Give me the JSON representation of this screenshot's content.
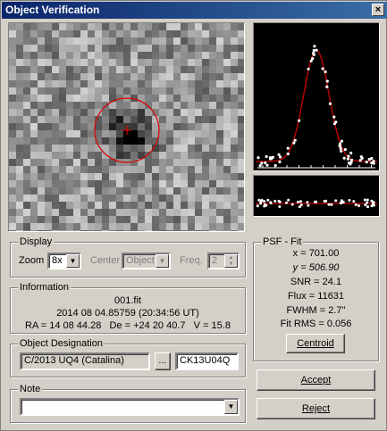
{
  "window": {
    "title": "Object Verification",
    "close_glyph": "×"
  },
  "display": {
    "label": "Display",
    "zoom_label": "Zoom",
    "zoom_value": "8x",
    "center_label": "Center",
    "center_value": "Object",
    "freq_label": "Freq.",
    "freq_value": "2"
  },
  "information": {
    "label": "Information",
    "filename": "001.fit",
    "datetime": "2014 08 04.85759 (20:34:56 UT)",
    "coords": "RA = 14 08 44.28   De = +24 20 40.7   V = 15.8"
  },
  "designation": {
    "label": "Object Designation",
    "name": "C/2013 UQ4 (Catalina)",
    "code": "CK13U04Q",
    "browse_label": "..."
  },
  "note": {
    "label": "Note",
    "value": ""
  },
  "psf": {
    "label": "PSF - Fit",
    "x": "x = 701.00",
    "y": "y = 506.90",
    "snr": "SNR = 24.1",
    "flux": "Flux = 11631",
    "fwhm": "FWHM = 2.7\"",
    "rms": "Fit RMS = 0.056",
    "centroid_label": "Centroid"
  },
  "buttons": {
    "accept_label": "Accept",
    "reject_label": "Reject"
  },
  "colors": {
    "title_start": "#0a246a",
    "title_end": "#3a6ea5",
    "fit_curve": "#cc0000",
    "marker": "#dd0000",
    "plot_bg": "#000000"
  }
}
